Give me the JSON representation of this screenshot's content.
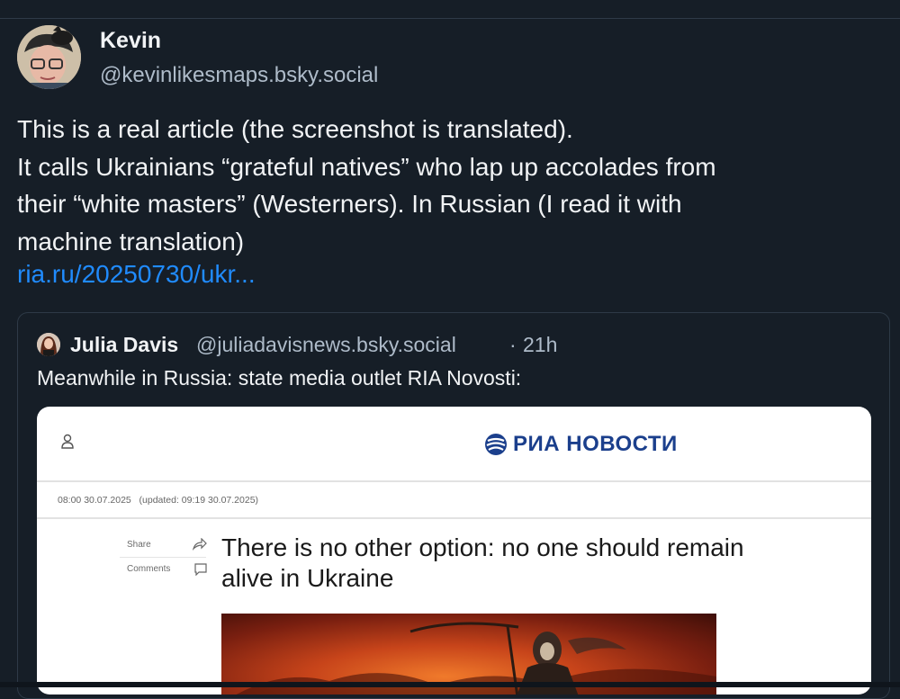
{
  "post": {
    "author_name": "Kevin",
    "author_handle": "@kevinlikesmaps.bsky.social",
    "text_lines": [
      "This is a real article (the screenshot is translated).",
      "It calls Ukrainians “grateful natives” who lap up accolades from",
      "their “white masters” (Westerners). In Russian (I read it with",
      "machine translation)"
    ],
    "link_text": "ria.ru/20250730/ukr..."
  },
  "quote": {
    "author_name": "Julia Davis",
    "author_handle": "@juliadavisnews.bsky.social",
    "separator": "·",
    "time": "21h",
    "text": "Meanwhile in Russia: state media outlet RIA Novosti:"
  },
  "screenshot": {
    "logo_text": "РИА НОВОСТИ",
    "date": "08:00 30.07.2025",
    "updated": "(updated: 09:19 30.07.2025)",
    "share_label": "Share",
    "comments_label": "Comments",
    "headline": "There is no other option: no one should remain alive in Ukraine"
  },
  "colors": {
    "background": "#161e27",
    "link": "#208bfe",
    "muted": "#aebbc9",
    "logo": "#1b3f8c"
  }
}
